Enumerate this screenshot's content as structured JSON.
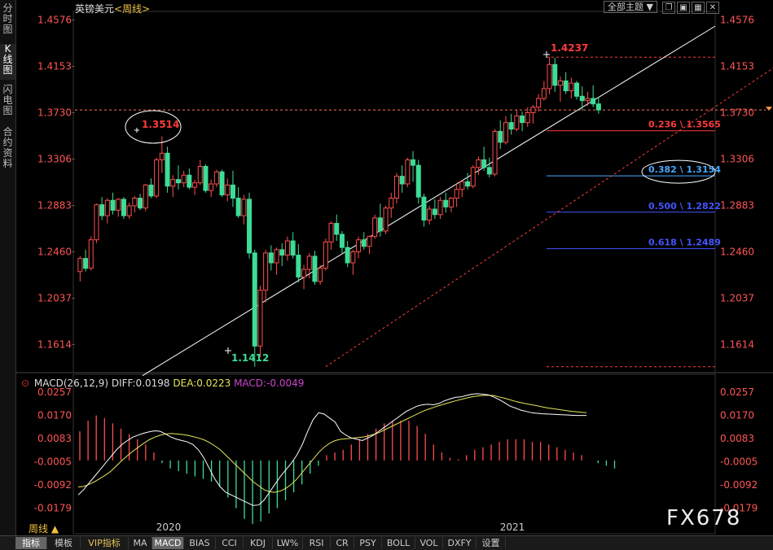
{
  "left_tabs": [
    "分时图",
    "K线图",
    "闪电图",
    "合约资料"
  ],
  "header": {
    "symbol": "英镑美元",
    "period": "<周线>",
    "theme_button": "全部主题",
    "controls": [
      "▼",
      "❐",
      "▣",
      "▦",
      "✕"
    ]
  },
  "macd_header": {
    "title": "MACD(26,12,9)",
    "diff": "DIFF:0.0198",
    "dea": "DEA:0.0223",
    "macd": "MACD:-0.0049"
  },
  "period_label": "周线 ▲",
  "watermark": "FX678",
  "bottom_tabs": [
    "指标",
    "模板",
    "VIP指标",
    "MA",
    "MACD",
    "BIAS",
    "CCI",
    "KDJ",
    "LW%",
    "RSI",
    "CR",
    "PSY",
    "BOLL",
    "VOL",
    "DXFY",
    "设置"
  ],
  "colors": {
    "up": "#ff4d4d",
    "down": "#3ddc97",
    "diff": "#ffffff",
    "dea": "#e6e65a",
    "macd_label": "#cc44cc",
    "fib": "#ff3b3b",
    "fib_highlight": "#4aa8ff",
    "fib_blue": "#4455ff"
  },
  "chart_data": {
    "type": "candlestick",
    "price_axis_ticks": [
      "1.4576",
      "1.4153",
      "1.3730",
      "1.3306",
      "1.2883",
      "1.2460",
      "1.2037",
      "1.1614"
    ],
    "ylim": [
      1.138,
      1.461
    ],
    "macd_axis_ticks": [
      "0.0257",
      "0.0170",
      "0.0083",
      "-0.0005",
      "-0.0092",
      "-0.0179"
    ],
    "macd_ylim": [
      -0.0215,
      0.027
    ],
    "x_labels": [
      "2020",
      "2021"
    ],
    "annotations": {
      "high_2019": "1.3514",
      "low_2020": "1.1412",
      "high_2021": "1.4237",
      "current_price": 1.3755
    },
    "fib_levels": [
      {
        "label": "0.236 \\ 1.3565",
        "value": 1.3565
      },
      {
        "label": "0.382 \\ 1.3154",
        "value": 1.3154
      },
      {
        "label": "0.500 \\ 1.2822",
        "value": 1.2822
      },
      {
        "label": "0.618 \\ 1.2489",
        "value": 1.2489
      }
    ],
    "fib_dashed_levels": [
      1.4237,
      1.1412
    ],
    "trendline": [
      [
        0,
        1.133
      ],
      [
        146,
        1.452
      ]
    ],
    "fib_diagonal": [
      [
        45,
        1.1412
      ],
      [
        130,
        1.4237
      ]
    ],
    "candles": [
      [
        1.228,
        1.242,
        1.219,
        1.24
      ],
      [
        1.24,
        1.248,
        1.228,
        1.231
      ],
      [
        1.231,
        1.26,
        1.229,
        1.257
      ],
      [
        1.257,
        1.29,
        1.254,
        1.289
      ],
      [
        1.289,
        1.296,
        1.275,
        1.279
      ],
      [
        1.279,
        1.295,
        1.272,
        1.293
      ],
      [
        1.293,
        1.3,
        1.28,
        1.284
      ],
      [
        1.284,
        1.295,
        1.278,
        1.294
      ],
      [
        1.294,
        1.296,
        1.276,
        1.279
      ],
      [
        1.279,
        1.291,
        1.276,
        1.288
      ],
      [
        1.288,
        1.297,
        1.282,
        1.295
      ],
      [
        1.295,
        1.299,
        1.284,
        1.286
      ],
      [
        1.286,
        1.308,
        1.283,
        1.307
      ],
      [
        1.307,
        1.313,
        1.295,
        1.297
      ],
      [
        1.297,
        1.332,
        1.295,
        1.33
      ],
      [
        1.33,
        1.3514,
        1.318,
        1.336
      ],
      [
        1.336,
        1.342,
        1.3,
        1.306
      ],
      [
        1.306,
        1.316,
        1.296,
        1.312
      ],
      [
        1.312,
        1.325,
        1.303,
        1.309
      ],
      [
        1.309,
        1.32,
        1.305,
        1.316
      ],
      [
        1.316,
        1.322,
        1.303,
        1.305
      ],
      [
        1.305,
        1.312,
        1.298,
        1.309
      ],
      [
        1.309,
        1.33,
        1.307,
        1.324
      ],
      [
        1.324,
        1.326,
        1.3,
        1.302
      ],
      [
        1.302,
        1.312,
        1.296,
        1.308
      ],
      [
        1.308,
        1.321,
        1.305,
        1.319
      ],
      [
        1.319,
        1.321,
        1.296,
        1.298
      ],
      [
        1.298,
        1.313,
        1.292,
        1.307
      ],
      [
        1.307,
        1.32,
        1.287,
        1.295
      ],
      [
        1.295,
        1.305,
        1.277,
        1.279
      ],
      [
        1.279,
        1.298,
        1.271,
        1.294
      ],
      [
        1.294,
        1.3,
        1.24,
        1.245
      ],
      [
        1.245,
        1.248,
        1.1412,
        1.16
      ],
      [
        1.16,
        1.215,
        1.15,
        1.211
      ],
      [
        1.211,
        1.248,
        1.2,
        1.245
      ],
      [
        1.245,
        1.252,
        1.229,
        1.236
      ],
      [
        1.236,
        1.25,
        1.225,
        1.248
      ],
      [
        1.248,
        1.254,
        1.233,
        1.243
      ],
      [
        1.243,
        1.26,
        1.238,
        1.256
      ],
      [
        1.256,
        1.264,
        1.24,
        1.243
      ],
      [
        1.243,
        1.253,
        1.218,
        1.223
      ],
      [
        1.223,
        1.234,
        1.212,
        1.23
      ],
      [
        1.23,
        1.245,
        1.222,
        1.242
      ],
      [
        1.242,
        1.247,
        1.216,
        1.219
      ],
      [
        1.219,
        1.234,
        1.216,
        1.231
      ],
      [
        1.231,
        1.258,
        1.229,
        1.255
      ],
      [
        1.255,
        1.274,
        1.248,
        1.272
      ],
      [
        1.272,
        1.28,
        1.256,
        1.262
      ],
      [
        1.262,
        1.265,
        1.245,
        1.25
      ],
      [
        1.25,
        1.256,
        1.232,
        1.236
      ],
      [
        1.236,
        1.248,
        1.225,
        1.246
      ],
      [
        1.246,
        1.26,
        1.24,
        1.257
      ],
      [
        1.257,
        1.264,
        1.248,
        1.251
      ],
      [
        1.251,
        1.261,
        1.244,
        1.26
      ],
      [
        1.26,
        1.28,
        1.258,
        1.277
      ],
      [
        1.277,
        1.29,
        1.26,
        1.265
      ],
      [
        1.265,
        1.288,
        1.262,
        1.286
      ],
      [
        1.286,
        1.3,
        1.277,
        1.295
      ],
      [
        1.295,
        1.318,
        1.29,
        1.315
      ],
      [
        1.315,
        1.325,
        1.3,
        1.308
      ],
      [
        1.308,
        1.332,
        1.305,
        1.33
      ],
      [
        1.33,
        1.338,
        1.31,
        1.325
      ],
      [
        1.325,
        1.33,
        1.29,
        1.296
      ],
      [
        1.296,
        1.299,
        1.269,
        1.275
      ],
      [
        1.275,
        1.288,
        1.271,
        1.285
      ],
      [
        1.285,
        1.294,
        1.276,
        1.28
      ],
      [
        1.28,
        1.296,
        1.276,
        1.293
      ],
      [
        1.293,
        1.3,
        1.282,
        1.287
      ],
      [
        1.287,
        1.296,
        1.282,
        1.295
      ],
      [
        1.295,
        1.308,
        1.287,
        1.303
      ],
      [
        1.303,
        1.311,
        1.296,
        1.31
      ],
      [
        1.31,
        1.318,
        1.303,
        1.306
      ],
      [
        1.306,
        1.325,
        1.304,
        1.323
      ],
      [
        1.323,
        1.333,
        1.316,
        1.33
      ],
      [
        1.33,
        1.342,
        1.32,
        1.323
      ],
      [
        1.323,
        1.332,
        1.314,
        1.317
      ],
      [
        1.317,
        1.358,
        1.315,
        1.356
      ],
      [
        1.356,
        1.366,
        1.34,
        1.346
      ],
      [
        1.346,
        1.37,
        1.344,
        1.364
      ],
      [
        1.364,
        1.372,
        1.353,
        1.358
      ],
      [
        1.358,
        1.376,
        1.356,
        1.37
      ],
      [
        1.37,
        1.374,
        1.356,
        1.364
      ],
      [
        1.364,
        1.378,
        1.36,
        1.373
      ],
      [
        1.373,
        1.38,
        1.363,
        1.378
      ],
      [
        1.378,
        1.39,
        1.374,
        1.386
      ],
      [
        1.386,
        1.402,
        1.384,
        1.395
      ],
      [
        1.395,
        1.4237,
        1.39,
        1.417
      ],
      [
        1.417,
        1.423,
        1.392,
        1.398
      ],
      [
        1.398,
        1.406,
        1.383,
        1.402
      ],
      [
        1.402,
        1.41,
        1.39,
        1.393
      ],
      [
        1.393,
        1.405,
        1.386,
        1.4
      ],
      [
        1.4,
        1.402,
        1.385,
        1.388
      ],
      [
        1.388,
        1.397,
        1.375,
        1.384
      ],
      [
        1.384,
        1.392,
        1.379,
        1.386
      ],
      [
        1.386,
        1.398,
        1.378,
        1.381
      ],
      [
        1.381,
        1.387,
        1.372,
        1.3755
      ]
    ],
    "macd": {
      "diff": [
        -0.013,
        -0.011,
        -0.0085,
        -0.006,
        -0.0035,
        -0.001,
        0.0015,
        0.004,
        0.006,
        0.0075,
        0.0088,
        0.0096,
        0.0103,
        0.0108,
        0.0112,
        0.011,
        0.01,
        0.0088,
        0.008,
        0.0075,
        0.007,
        0.006,
        0.004,
        0.001,
        -0.003,
        -0.007,
        -0.01,
        -0.012,
        -0.013,
        -0.014,
        -0.015,
        -0.016,
        -0.017,
        -0.0168,
        -0.015,
        -0.012,
        -0.009,
        -0.006,
        -0.0035,
        -0.001,
        0.002,
        0.006,
        0.011,
        0.0155,
        0.018,
        0.0175,
        0.016,
        0.0145,
        0.011,
        0.0095,
        0.0085,
        0.008,
        0.0075,
        0.0085,
        0.0095,
        0.011,
        0.0125,
        0.014,
        0.0155,
        0.017,
        0.0185,
        0.0195,
        0.0205,
        0.021,
        0.0212,
        0.021,
        0.0215,
        0.0225,
        0.0232,
        0.0238,
        0.024,
        0.0245,
        0.025,
        0.0252,
        0.025,
        0.0248,
        0.024,
        0.023,
        0.0218,
        0.0205,
        0.0198,
        0.019,
        0.0185,
        0.018,
        0.0178,
        0.0176,
        0.0175,
        0.0174,
        0.0173,
        0.0172,
        0.0171,
        0.017,
        0.017,
        0.017
      ],
      "dea": [
        -0.01,
        -0.0098,
        -0.009,
        -0.008,
        -0.0068,
        -0.0055,
        -0.004,
        -0.002,
        0.0,
        0.0018,
        0.0035,
        0.005,
        0.0065,
        0.0078,
        0.0088,
        0.0095,
        0.01,
        0.0102,
        0.01,
        0.0098,
        0.0095,
        0.009,
        0.0085,
        0.0078,
        0.0068,
        0.0055,
        0.004,
        0.002,
        0.0,
        -0.002,
        -0.004,
        -0.006,
        -0.008,
        -0.0095,
        -0.011,
        -0.0118,
        -0.012,
        -0.0115,
        -0.0105,
        -0.009,
        -0.007,
        -0.0045,
        -0.002,
        0.0005,
        0.003,
        0.005,
        0.0065,
        0.0075,
        0.008,
        0.0082,
        0.0084,
        0.0086,
        0.0088,
        0.0092,
        0.0098,
        0.0105,
        0.0115,
        0.0125,
        0.0135,
        0.0145,
        0.0155,
        0.0165,
        0.0175,
        0.0185,
        0.0193,
        0.02,
        0.0207,
        0.0213,
        0.0219,
        0.0225,
        0.023,
        0.0235,
        0.024,
        0.0243,
        0.0245,
        0.0246,
        0.0245,
        0.024,
        0.0235,
        0.0229,
        0.0223,
        0.0218,
        0.0214,
        0.021,
        0.0206,
        0.0202,
        0.0198,
        0.0195,
        0.0192,
        0.0189,
        0.0186,
        0.0184,
        0.0182,
        0.018
      ],
      "hist": [
        0.011,
        0.015,
        0.017,
        0.016,
        0.014,
        0.012,
        0.01,
        0.008,
        0.006,
        0.003,
        -0.001,
        -0.003,
        -0.004,
        -0.005,
        -0.006,
        -0.007,
        -0.008,
        -0.01,
        -0.014,
        -0.018,
        -0.022,
        -0.024,
        -0.023,
        -0.02,
        -0.018,
        -0.015,
        -0.012,
        -0.009,
        -0.005,
        -0.002,
        0.002,
        0.003,
        0.004,
        0.006,
        0.008,
        0.01,
        0.012,
        0.014,
        0.015,
        0.015,
        0.015,
        0.013,
        0.01,
        0.006,
        0.003,
        0.001,
        0.0005,
        0.002,
        0.004,
        0.005,
        0.006,
        0.007,
        0.008,
        0.008,
        0.008,
        0.007,
        0.007,
        0.006,
        0.005,
        0.004,
        0.003,
        0.002,
        0.0,
        -0.001,
        -0.002,
        -0.003
      ]
    }
  }
}
